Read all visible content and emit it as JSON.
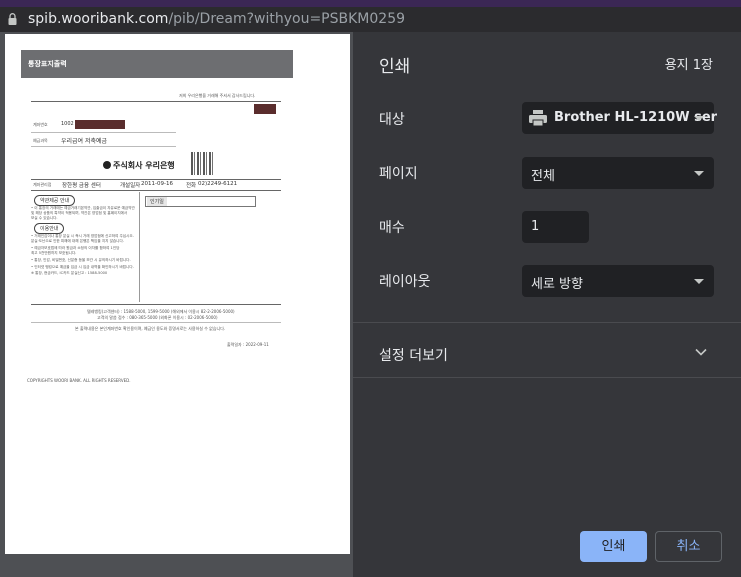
{
  "browser": {
    "url_host": "spib.wooribank.com",
    "url_rest": "/pib/Dream?withyou=PSBKM0259"
  },
  "print_panel": {
    "title": "인쇄",
    "page_count": "용지 1장",
    "destination_label": "대상",
    "destination_value": "Brother HL-1210W ser",
    "pages_label": "페이지",
    "pages_value": "전체",
    "copies_label": "매수",
    "copies_value": "1",
    "layout_label": "레이아웃",
    "layout_value": "세로 방향",
    "more_settings": "설정 더보기",
    "print_button": "인쇄",
    "cancel_button": "취소"
  },
  "document": {
    "header": "통장표지출력",
    "notice": "저희 우리은행을 거래해 주셔서 감사드립니다.",
    "account_label": "계좌번호",
    "account_prefix": "1002",
    "product_label": "예금과목",
    "product_value": "우리급여 저축예금",
    "bank_name": "주식회사 우리은행",
    "branch_label": "계좌관리점",
    "branch_value": "장한평 금융 센터",
    "opened_label": "개설일자",
    "opened_value": "2011-09-16",
    "phone_label": "전화",
    "phone_value": "02)2249-6121",
    "section1": "약관제공 안내",
    "section2": "이용안내",
    "field_box": "인기일",
    "bullets": [
      "• 이 통장의 거래에는 예금거래기본약관, 입출금이 자유로운 예금약관",
      "  및 해당 상품의 특약이 적용되며, 약관은 영업점 및 홈페이지에서",
      "  보실 수 있습니다.",
      "• 거래인감이나 통장 분실 시 즉시 거래 영업점에 신고하여 주십시오.",
      "  분실·도난으로 인한 피해에 대해 은행은 책임을 지지 않습니다.",
      "• 예금자보호법에 따라 원금과 소정의 이자를 합하여 1인당",
      "  최고 5천만원까지 보호됩니다.",
      "• 통장, 인감, 비밀번호, 신분증 등을 보관 시 유의하시기 바랍니다.",
      "• 인터넷 뱅킹으로 예금을 입금 시 입금 내역을 확인하시기 바랍니다.",
      "  ※ 통장, 현금카드, IC카드 분실신고 : 1588-5000"
    ],
    "footer1": "텔레뱅킹(고객센터) : 1588-5000, 1599-5000 (해외에서 이용시 82-2-2006-5000)",
    "footer2": "고객의 말씀 접수 : 080-365-5000 (외화폰 이용시 : 02-2006-5000)",
    "footer3": "본 출력내용은 본인계좌번호 확인용이며, 예금인 용도와 증명서로는 사용하실 수 없습니다.",
    "printed_date": "출력일자 : 2022-09-11",
    "copyright": "COPYRIGHTS WOORI BANK. ALL RIGHTS RESERVED."
  },
  "colors": {
    "panel_bg": "#35363a",
    "accent": "#8ab4f8"
  }
}
